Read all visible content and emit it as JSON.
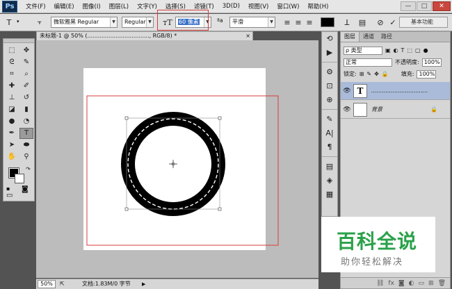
{
  "app": {
    "logo": "Ps"
  },
  "menu": [
    "文件(F)",
    "编辑(E)",
    "图像(I)",
    "图层(L)",
    "文字(Y)",
    "选择(S)",
    "滤镜(T)",
    "3D(D)",
    "视图(V)",
    "窗口(W)",
    "帮助(H)"
  ],
  "window_controls": {
    "minimize": "—",
    "restore": "□",
    "close": "✕"
  },
  "options": {
    "font_family": "微软雅黑 Regular",
    "font_style": "Regular",
    "font_size": "60 像素",
    "antialias_label": "ªa",
    "antialias": "平滑",
    "workspace": "基本功能"
  },
  "document": {
    "tab_title": "未标题-1 @ 50% (..................................., RGB/8) *",
    "zoom": "50%",
    "doc_info": "文档:1.83M/0 字节"
  },
  "layers_panel": {
    "tabs": [
      "图层",
      "通道",
      "路径"
    ],
    "filter": "ρ 类型",
    "blend_mode": "正常",
    "opacity_label": "不透明度:",
    "opacity": "100%",
    "lock_label": "锁定:",
    "fill_label": "填充:",
    "fill": "100%",
    "layers": [
      {
        "thumb": "T",
        "name": "................................"
      },
      {
        "thumb": "",
        "name": "背景"
      }
    ]
  },
  "watermark": {
    "title": "百科全说",
    "subtitle": "助你轻松解决"
  },
  "colors": {
    "accent_red": "#d93b3b",
    "selection_blue": "#3a72c8",
    "watermark_green": "#2aa14a"
  }
}
